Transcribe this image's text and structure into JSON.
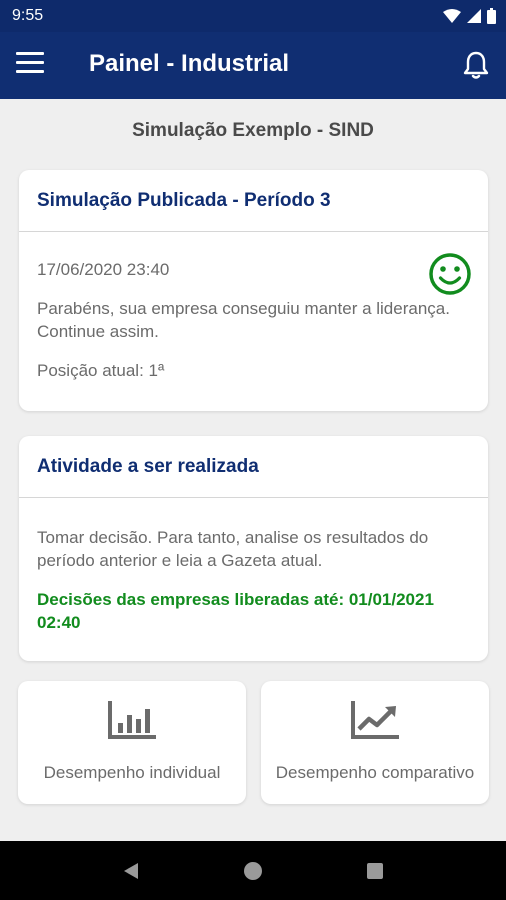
{
  "status_bar": {
    "time": "9:55",
    "icons": [
      "wifi-icon",
      "signal-icon",
      "battery-icon"
    ]
  },
  "app_bar": {
    "title": "Painel - Industrial",
    "menu_icon": "menu-icon",
    "notification_icon": "bell-icon"
  },
  "simulation_name": "Simulação Exemplo - SIND",
  "published_card": {
    "title": "Simulação Publicada - Período 3",
    "date": "17/06/2020 23:40",
    "message": "Parabéns, sua empresa conseguiu manter a liderança. Continue assim.",
    "position": "Posição atual: 1ª",
    "mood_icon": "smiley-icon",
    "mood_color": "#128c1e"
  },
  "activity_card": {
    "title": "Atividade a ser realizada",
    "instruction": "Tomar decisão. Para tanto, analise os resultados do período anterior e leia a Gazeta atual.",
    "deadline": "Decisões das empresas liberadas até: 01/01/2021 02:40",
    "deadline_color": "#128c1e"
  },
  "tiles": [
    {
      "label": "Desempenho individual",
      "icon": "bar-chart-icon"
    },
    {
      "label": "Desempenho comparativo",
      "icon": "trending-up-icon"
    }
  ],
  "nav_bar": {
    "buttons": [
      "back-icon",
      "home-icon",
      "recents-icon"
    ]
  },
  "colors": {
    "primary": "#102e72",
    "background": "#efefef",
    "success": "#128c1e"
  }
}
